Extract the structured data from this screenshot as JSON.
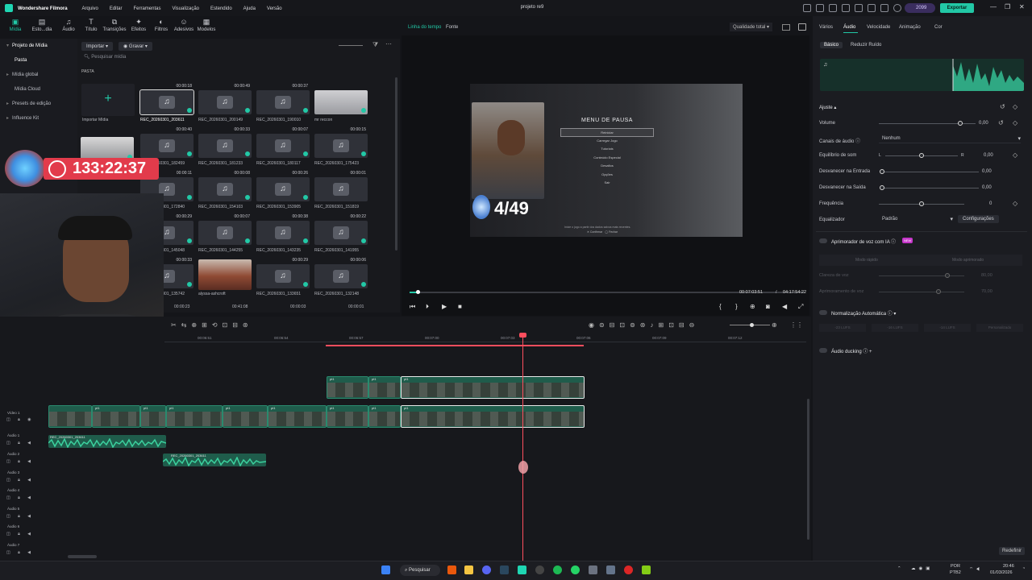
{
  "titlebar": {
    "app_name": "Wondershare Filmora",
    "menu": [
      "Arquivo",
      "Editar",
      "Ferramentas",
      "Visualização",
      "Estendido",
      "Ajuda",
      "Versão"
    ],
    "project_title": "projeto re9",
    "credits": "2099",
    "export_label": "Exportar",
    "accent_color": "#22c8a6"
  },
  "tool_tabs": [
    "Mídia",
    "Esto...dia",
    "Áudio",
    "Título",
    "Transições",
    "Efeitos",
    "Filtros",
    "Adesivos",
    "Modelos"
  ],
  "media_sidebar": [
    "Projeto de Mídia",
    "Pasta",
    "Mídia global",
    "Mídia Cloud",
    "Presets de edição",
    "Influence Kit"
  ],
  "media_panel": {
    "import_label": "Importar",
    "record_label": "Gravar",
    "search_placeholder": "Pesquisar mídia",
    "folder_label": "PASTA",
    "import_media_label": "Importar Mídia",
    "items": [
      {
        "name": "REC_20260301_203611",
        "dur": "00:00:18"
      },
      {
        "name": "REC_20260301_200149",
        "dur": "00:00:49"
      },
      {
        "name": "REC_20260301_190010",
        "dur": "00:00:37"
      },
      {
        "name": "mr reccon",
        "dur": ""
      },
      {
        "name": "REC_20260301_182459",
        "dur": "00:00:40"
      },
      {
        "name": "REC_20260301_181233",
        "dur": "00:00:33"
      },
      {
        "name": "REC_20260301_180117",
        "dur": "00:00:07"
      },
      {
        "name": "REC_20260301_175423",
        "dur": "00:00:15"
      },
      {
        "name": "REC_20260301_172840",
        "dur": "00:00:11"
      },
      {
        "name": "REC_20260301_154103",
        "dur": "00:00:08"
      },
      {
        "name": "REC_20260301_153905",
        "dur": "00:00:26"
      },
      {
        "name": "REC_20260301_151819",
        "dur": "00:00:01"
      },
      {
        "name": "REC_20260301_145048",
        "dur": "00:00:29"
      },
      {
        "name": "REC_20260301_144255",
        "dur": "00:00:07"
      },
      {
        "name": "REC_20260301_143235",
        "dur": "00:00:38"
      },
      {
        "name": "REC_20260301_141955",
        "dur": "00:00:22"
      },
      {
        "name": "REC_20260301_135742",
        "dur": "00:00:33"
      },
      {
        "name": "alyssa-ashcroft",
        "dur": ""
      },
      {
        "name": "REC_20260301_133651",
        "dur": "00:00:29"
      },
      {
        "name": "REC_20260301_132148",
        "dur": "00:00:06"
      }
    ],
    "bottom_durs": [
      "00:00:23",
      "00:41:08",
      "00:00:03",
      "00:00:01"
    ]
  },
  "overlay": {
    "timer": "133:22:37"
  },
  "preview": {
    "tab_timeline": "Linha do tempo",
    "tab_source": "Fonte",
    "quality": "Qualidade total",
    "game": {
      "menu_title": "MENU DE PAUSA",
      "items": [
        "Reiniciar",
        "Carregar Jogo",
        "Tutoriais",
        "Conteúdo Especial",
        "Desafios",
        "Opções",
        "Sair"
      ],
      "footer_hint": "Inicie o jogo a partir dos dados salvos mais recentes.",
      "footer_confirm": "Confirmar",
      "footer_close": "Fechar",
      "trophies": "4/49"
    },
    "time_current": "00:07:03:51",
    "time_sep": "/",
    "time_total": "04:17:54:22",
    "progress_fraction": 0.027
  },
  "right_panel": {
    "tabs": [
      "Vários",
      "Áudio",
      "Velocidade",
      "Animação",
      "Cor"
    ],
    "subtabs": [
      "Básico",
      "Reduzir Ruído"
    ],
    "adjust_title": "Ajuste",
    "volume": {
      "label": "Volume",
      "value": "0,00",
      "level": 0.84
    },
    "channels": {
      "label": "Canais de áudio",
      "value": "Nenhum"
    },
    "balance": {
      "label": "Equilíbrio de som",
      "left": "L",
      "right": "R",
      "value": "0,00",
      "level": 0.5
    },
    "fade_in": {
      "label": "Desvanecer na Entrada",
      "value": "0,00",
      "level": 0
    },
    "fade_out": {
      "label": "Desvanecer na Saída",
      "value": "0,00",
      "level": 0
    },
    "pitch": {
      "label": "Frequência",
      "value": "0",
      "level": 0.5
    },
    "equalizer": {
      "label": "Equalizador",
      "value": "Padrão",
      "config": "Configurações"
    },
    "ai_voice": {
      "label": "Aprimorador de voz com IA",
      "badge": "NEW",
      "mode_fast": "Modo rápido",
      "mode_enhanced": "Modo aprimorado",
      "clarity_label": "Clareza de voz",
      "clarity_value": "80,00",
      "clarity_level": 0.8,
      "enhance_label": "Aprimoramento de voz",
      "enhance_value": "70,00",
      "enhance_level": 0.7
    },
    "auto_norm": {
      "label": "Normalização Automática",
      "options": [
        "-23 LUFS",
        "-16 LUFS",
        "-14 LUFS",
        "Personalizado"
      ]
    },
    "ducking": {
      "label": "Áudio ducking"
    },
    "reset": "Redefinir"
  },
  "timeline": {
    "ruler": [
      "00:06:51",
      "00:06:54",
      "00:06:57",
      "00:07:00",
      "00:07:03",
      "00:07:06",
      "00:07:09",
      "00:07:12"
    ],
    "tracks": [
      "Vídeo 1",
      "Áudio 1",
      "Áudio 2",
      "Áudio 3",
      "Áudio 4",
      "Áudio 5",
      "Áudio 6",
      "Áudio 7"
    ],
    "clip_label": "pt1",
    "audio1_label": "REC_20260301_203611",
    "audio2_label": "REC_20260301_203611"
  },
  "taskbar": {
    "search": "Pesquisar",
    "lang": "POR",
    "layout": "PTB2",
    "time": "20:46",
    "date": "01/03/2026"
  }
}
